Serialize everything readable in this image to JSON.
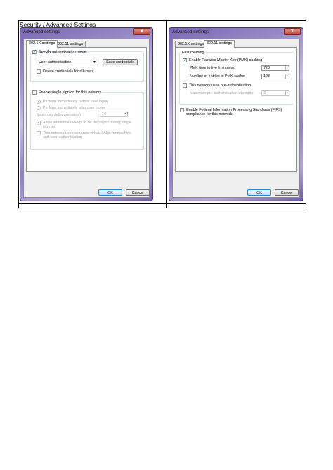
{
  "document": {
    "cell_title": "Security / Advanced Settings"
  },
  "left_dialog": {
    "title": "Advanced settings",
    "close_glyph": "x",
    "tabs": [
      {
        "label": "802.1X settings",
        "active": true
      },
      {
        "label": "802.11 settings",
        "active": false
      }
    ],
    "auth_group": {
      "specify_mode": {
        "label": "Specify authentication mode:",
        "checked": true
      },
      "mode_select": {
        "value": "User authentication"
      },
      "save_credentials_label": "Save credentials",
      "delete_credentials": {
        "label": "Delete credentials for all users",
        "checked": false
      }
    },
    "sso_group": {
      "enable_sso": {
        "label": "Enable single sign on for this network",
        "checked": false
      },
      "perform_before": {
        "label": "Perform immediately before user logon",
        "selected": true
      },
      "perform_after": {
        "label": "Perform immediately after user logon",
        "selected": false
      },
      "max_delay": {
        "label": "Maximum delay (seconds):",
        "value": "10"
      },
      "allow_dialogs": {
        "label": "Allow additional dialogs to be displayed during single sign on",
        "checked": true
      },
      "separate_vlans": {
        "label": "This network uses separate virtual LANs for machine and user authentication",
        "checked": false
      }
    },
    "ok_label": "OK",
    "cancel_label": "Cancel"
  },
  "right_dialog": {
    "title": "Advanced settings",
    "close_glyph": "x",
    "tabs": [
      {
        "label": "802.1X settings",
        "active": false
      },
      {
        "label": "802.11 settings",
        "active": true
      }
    ],
    "fast_roaming": {
      "label": "Fast roaming",
      "enable_pmk": {
        "label": "Enable Pairwise Master Key (PMK) caching",
        "checked": true
      },
      "pmk_ttl": {
        "label": "PMK time to live (minutes):",
        "value": "720"
      },
      "pmk_entries": {
        "label": "Number of entries in PMK cache:",
        "value": "128"
      },
      "pre_auth": {
        "label": "This network uses pre-authentication",
        "checked": false
      },
      "max_pre_auth": {
        "label": "Maximum pre-authentication attempts:",
        "value": "3"
      }
    },
    "fips": {
      "label": "Enable Federal Information Processing Standards (FIPS) compliance for this network",
      "checked": false
    },
    "ok_label": "OK",
    "cancel_label": "Cancel"
  }
}
